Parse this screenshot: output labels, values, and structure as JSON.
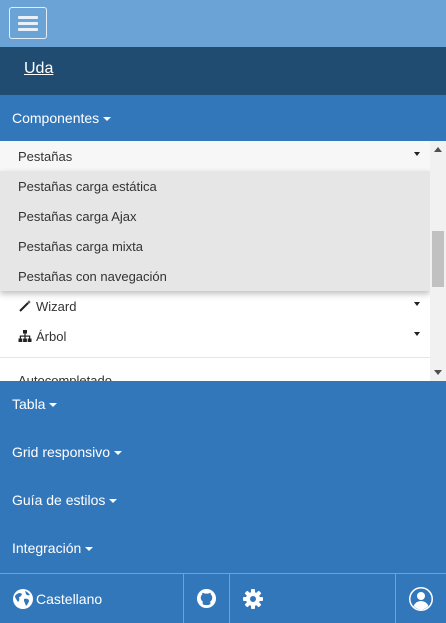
{
  "header": {
    "menu_toggle": "toggle-navigation"
  },
  "brand": {
    "label": "Uda"
  },
  "nav": {
    "componentes": "Componentes",
    "tabla": "Tabla",
    "grid": "Grid responsivo",
    "guia": "Guía de estilos",
    "integracion": "Integración"
  },
  "dropdown": {
    "open_item": "Pestañas",
    "subitems": [
      "Pestañas carga estática",
      "Pestañas carga Ajax",
      "Pestañas carga mixta",
      "Pestañas con navegación"
    ],
    "items": [
      {
        "label": "Wizard",
        "icon": "magic-wand-icon"
      },
      {
        "label": "Árbol",
        "icon": "sitemap-icon"
      }
    ],
    "partial_item": "Autocompletado"
  },
  "footer": {
    "language": "Castellano",
    "icons": [
      "globe-icon",
      "github-icon",
      "gear-icon",
      "user-icon"
    ]
  },
  "colors": {
    "topbar": "#6ca3d6",
    "brandbar": "#214c72",
    "nav": "#3377bb",
    "submenu": "#e6e6e6"
  }
}
